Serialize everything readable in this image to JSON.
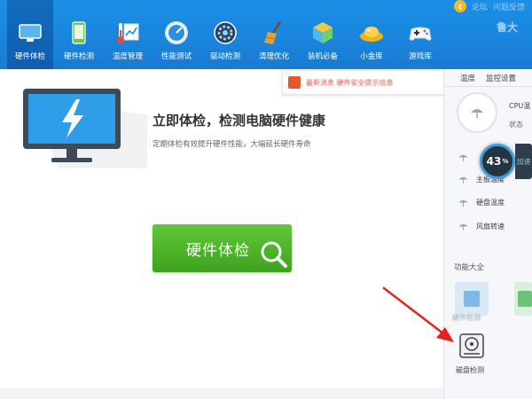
{
  "toolbar": {
    "items": [
      {
        "label": "硬件体检",
        "icon": "monitor-check-icon",
        "active": true
      },
      {
        "label": "硬件检测",
        "icon": "phone-check-icon"
      },
      {
        "label": "温度管理",
        "icon": "thermometer-chart-icon"
      },
      {
        "label": "性能测试",
        "icon": "speed-gauge-icon"
      },
      {
        "label": "驱动检测",
        "icon": "gear-icon"
      },
      {
        "label": "清理优化",
        "icon": "broom-icon"
      },
      {
        "label": "装机必备",
        "icon": "cube-icon"
      },
      {
        "label": "小金库",
        "icon": "gold-ingot-icon"
      },
      {
        "label": "游戏库",
        "icon": "gamepad-icon"
      }
    ],
    "top_right": {
      "coin_symbol": "¢",
      "link1": "论坛",
      "link2": "问题反馈"
    },
    "user_tag": "鲁大"
  },
  "hero": {
    "title": "立即体检，检测电脑硬件健康",
    "subtitle": "定期体检有效提升硬件性能，大幅延长硬件寿命",
    "button_label": "硬件体检"
  },
  "banner": {
    "text": "最新消息 硬件安全提示信息"
  },
  "right_panel": {
    "tab_temp": "温度",
    "tab_monitor": "监控设置",
    "cpu_label": "CPU温",
    "status_label": "状态",
    "rows": [
      "主板温度",
      "硬盘温度",
      "风扇转速"
    ],
    "usage_value": "43",
    "usage_unit": "%",
    "usage_tab": "加速",
    "functions_title": "功能大全",
    "tile_label_1": "硬件检测",
    "disk_label": "磁盘检测"
  },
  "colors": {
    "toolbar_blue": "#1a84dc",
    "button_green": "#4cb329",
    "arrow_red": "#e02424"
  }
}
